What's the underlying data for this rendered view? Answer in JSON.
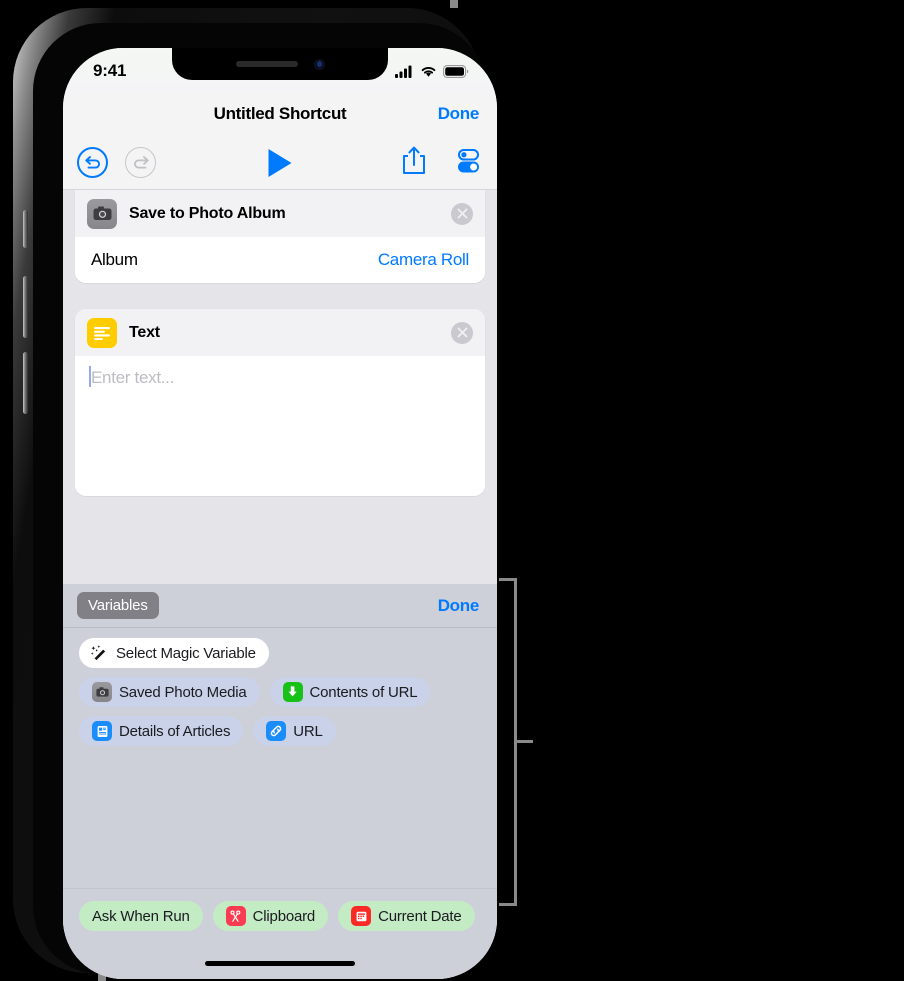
{
  "status_bar": {
    "time": "9:41",
    "icons": [
      "cellular-signal-icon",
      "wifi-icon",
      "battery-icon"
    ]
  },
  "nav_bar": {
    "title": "Untitled Shortcut",
    "done_label": "Done"
  },
  "toolbar": {
    "undo_icon": "undo-arrow-icon",
    "redo_icon": "redo-arrow-icon",
    "play_icon": "play-triangle-icon",
    "share_icon": "share-box-arrow-up-icon",
    "settings_icon": "toggles-settings-icon",
    "undo_enabled": true,
    "redo_enabled": false
  },
  "actions": [
    {
      "title": "Save to Photo Album",
      "icon": "camera-icon",
      "icon_color": "#8f8f93",
      "clear_icon": "clear-circle-x-icon",
      "parameters": [
        {
          "label": "Album",
          "value": "Camera Roll"
        }
      ]
    },
    {
      "title": "Text",
      "icon": "text-lines-icon",
      "icon_color": "#ffcc00",
      "clear_icon": "clear-circle-x-icon",
      "text_field": {
        "value": "",
        "placeholder": "Enter text..."
      }
    }
  ],
  "variables_panel": {
    "tab_label": "Variables",
    "done_label": "Done",
    "magic_variable": {
      "label": "Select Magic Variable",
      "icon": "magic-wand-icon"
    },
    "variable_chips": [
      [
        {
          "label": "Saved Photo Media",
          "icon": "camera-icon",
          "color": "#c9d2e8"
        },
        {
          "label": "Contents of URL",
          "icon": "download-arrow-icon",
          "color": "#c9d2e8"
        }
      ],
      [
        {
          "label": "Details of Articles",
          "icon": "article-icon",
          "color": "#c9d2e8"
        },
        {
          "label": "URL",
          "icon": "link-icon",
          "color": "#c9d2e8"
        }
      ]
    ],
    "special_chips": [
      {
        "label": "Ask When Run",
        "icon": "",
        "color": "#c3ebc4"
      },
      {
        "label": "Clipboard",
        "icon": "scissors-icon",
        "color": "#c3ebc4"
      },
      {
        "label": "Current Date",
        "icon": "calendar-icon",
        "color": "#c3ebc4"
      }
    ]
  },
  "colors": {
    "accent_blue": "#007aff",
    "panel_gray": "#ced0d9",
    "content_gray": "#e4e4e9",
    "chip_blue": "#c9d2e8",
    "chip_green": "#c3ebc4",
    "annotation_gray": "#8a8a8a"
  },
  "home_indicator": "home-indicator-bar"
}
